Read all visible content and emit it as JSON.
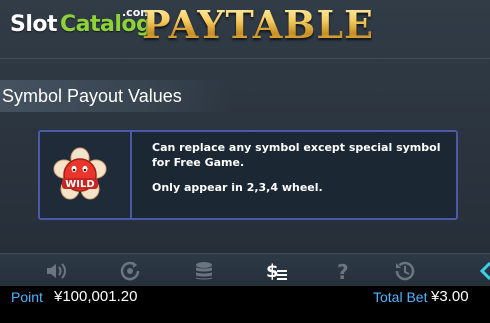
{
  "watermark": {
    "slot": "Slot",
    "catalog": "Catalog",
    "com": ".com"
  },
  "header": {
    "title": "PAYTABLE"
  },
  "section": {
    "title": "Symbol Payout Values"
  },
  "symbol_card": {
    "icon": "wild-flower-symbol",
    "icon_text": "WILD",
    "description_1": "Can replace any symbol except special symbol for Free Game.",
    "description_2": "Only appear in 2,3,4 wheel."
  },
  "toolbar": {
    "icons": [
      "sound-icon",
      "autoplay-icon",
      "coin-stack-icon",
      "paytable-icon",
      "help-icon",
      "history-icon",
      "collapse-icon"
    ],
    "paytable_active": true,
    "active_color": "#ffffff",
    "inactive_color": "#6b7580"
  },
  "status": {
    "point_label": "Point",
    "point_value": "¥100,001.20",
    "bet_label": "Total Bet",
    "bet_value": "¥3.00",
    "label_color": "#4fb4ff"
  }
}
